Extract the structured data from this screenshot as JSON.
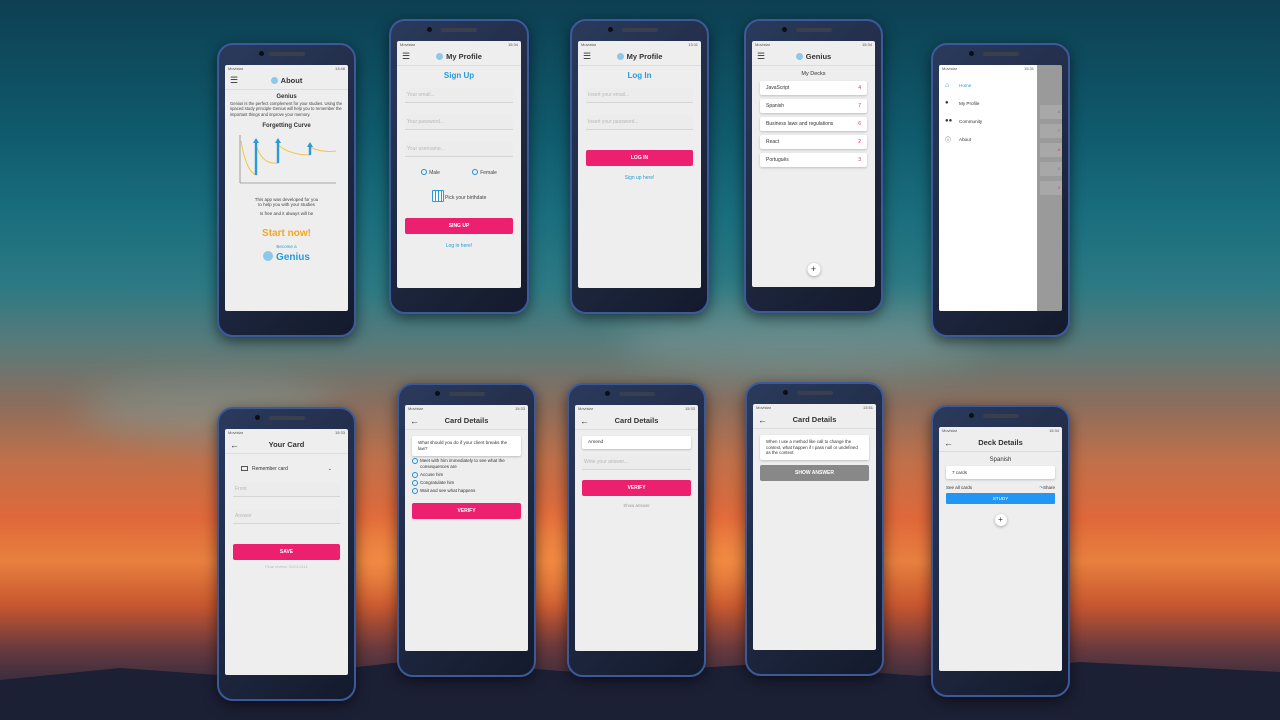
{
  "status": {
    "carrier": "Movistar",
    "t1": "13:48",
    "t2": "15:34",
    "t3": "13:11",
    "t4": "15:34",
    "t5": "15:31",
    "t6": "15:33",
    "t7": "15:33",
    "t8": "15:33",
    "t9": "13:51",
    "t10": "15:34"
  },
  "about": {
    "title": "About",
    "heading": "Genius",
    "description": "Genius is the perfect complement for your studies. Using the spaced study principle Genius will help you to remember the important things and improve your memory.",
    "curve_title": "Forgetting Curve",
    "dev_line1": "This app was developed for you",
    "dev_line2": "to help you with your studies",
    "free_line": "Is free and it always will be",
    "start": "Start now!",
    "become": "Become a",
    "genius": "Genius"
  },
  "signup": {
    "appbar": "My Profile",
    "heading": "Sign Up",
    "email": "Your email...",
    "password": "Your password...",
    "username": "Your username...",
    "male": "Male",
    "female": "Female",
    "birthdate": "Pick your birthdate",
    "button": "SING UP",
    "login_link": "Log in here!"
  },
  "login": {
    "appbar": "My Profile",
    "heading": "Log In",
    "email": "Insert your email...",
    "password": "Insert your password...",
    "button": "LOG IN",
    "signup_link": "Sign up here!"
  },
  "decks": {
    "appbar": "Genius",
    "heading": "My Decks",
    "items": [
      {
        "name": "JavaScript",
        "count": "4"
      },
      {
        "name": "Spanish",
        "count": "7"
      },
      {
        "name": "Business laws and regulations",
        "count": "6"
      },
      {
        "name": "React",
        "count": "2"
      },
      {
        "name": "Português",
        "count": "3"
      }
    ],
    "add": "+"
  },
  "drawer": {
    "items": [
      "Home",
      "My Profile",
      "Community",
      "About"
    ],
    "peek": [
      "4",
      "7",
      "6",
      "2",
      "3"
    ]
  },
  "yourcard": {
    "title": "Your Card",
    "dropdown": "Remember card",
    "front": "Front",
    "answer": "Answer",
    "button": "SAVE",
    "hint": "Final review: 01/01/1111"
  },
  "quiz": {
    "title": "Card Details",
    "question": "What should you do if your client breaks the law?",
    "options": [
      "Meet with him immediately to see what the consequences are",
      "Accuse him",
      "Congratulate him",
      "Wait and see what happens"
    ],
    "button": "VERIFY"
  },
  "write": {
    "title": "Card Details",
    "question": "Amend",
    "answer_placeholder": "Write your answer...",
    "button": "VERIFY",
    "show": "Show answer"
  },
  "show": {
    "title": "Card Details",
    "question": "When I use a method like call to change the context, what happen if I pass null or undefined as the context",
    "button": "SHOW ANSWER"
  },
  "deckdetails": {
    "title": "Deck Details",
    "deck": "Spanish",
    "count": "7 cards",
    "see_all": "See all cards",
    "share": "Share",
    "study": "STUDY",
    "add": "+"
  },
  "colors": {
    "pink": "#ed1f6f",
    "blue": "#2a9bd6",
    "orange": "#f5a623"
  }
}
